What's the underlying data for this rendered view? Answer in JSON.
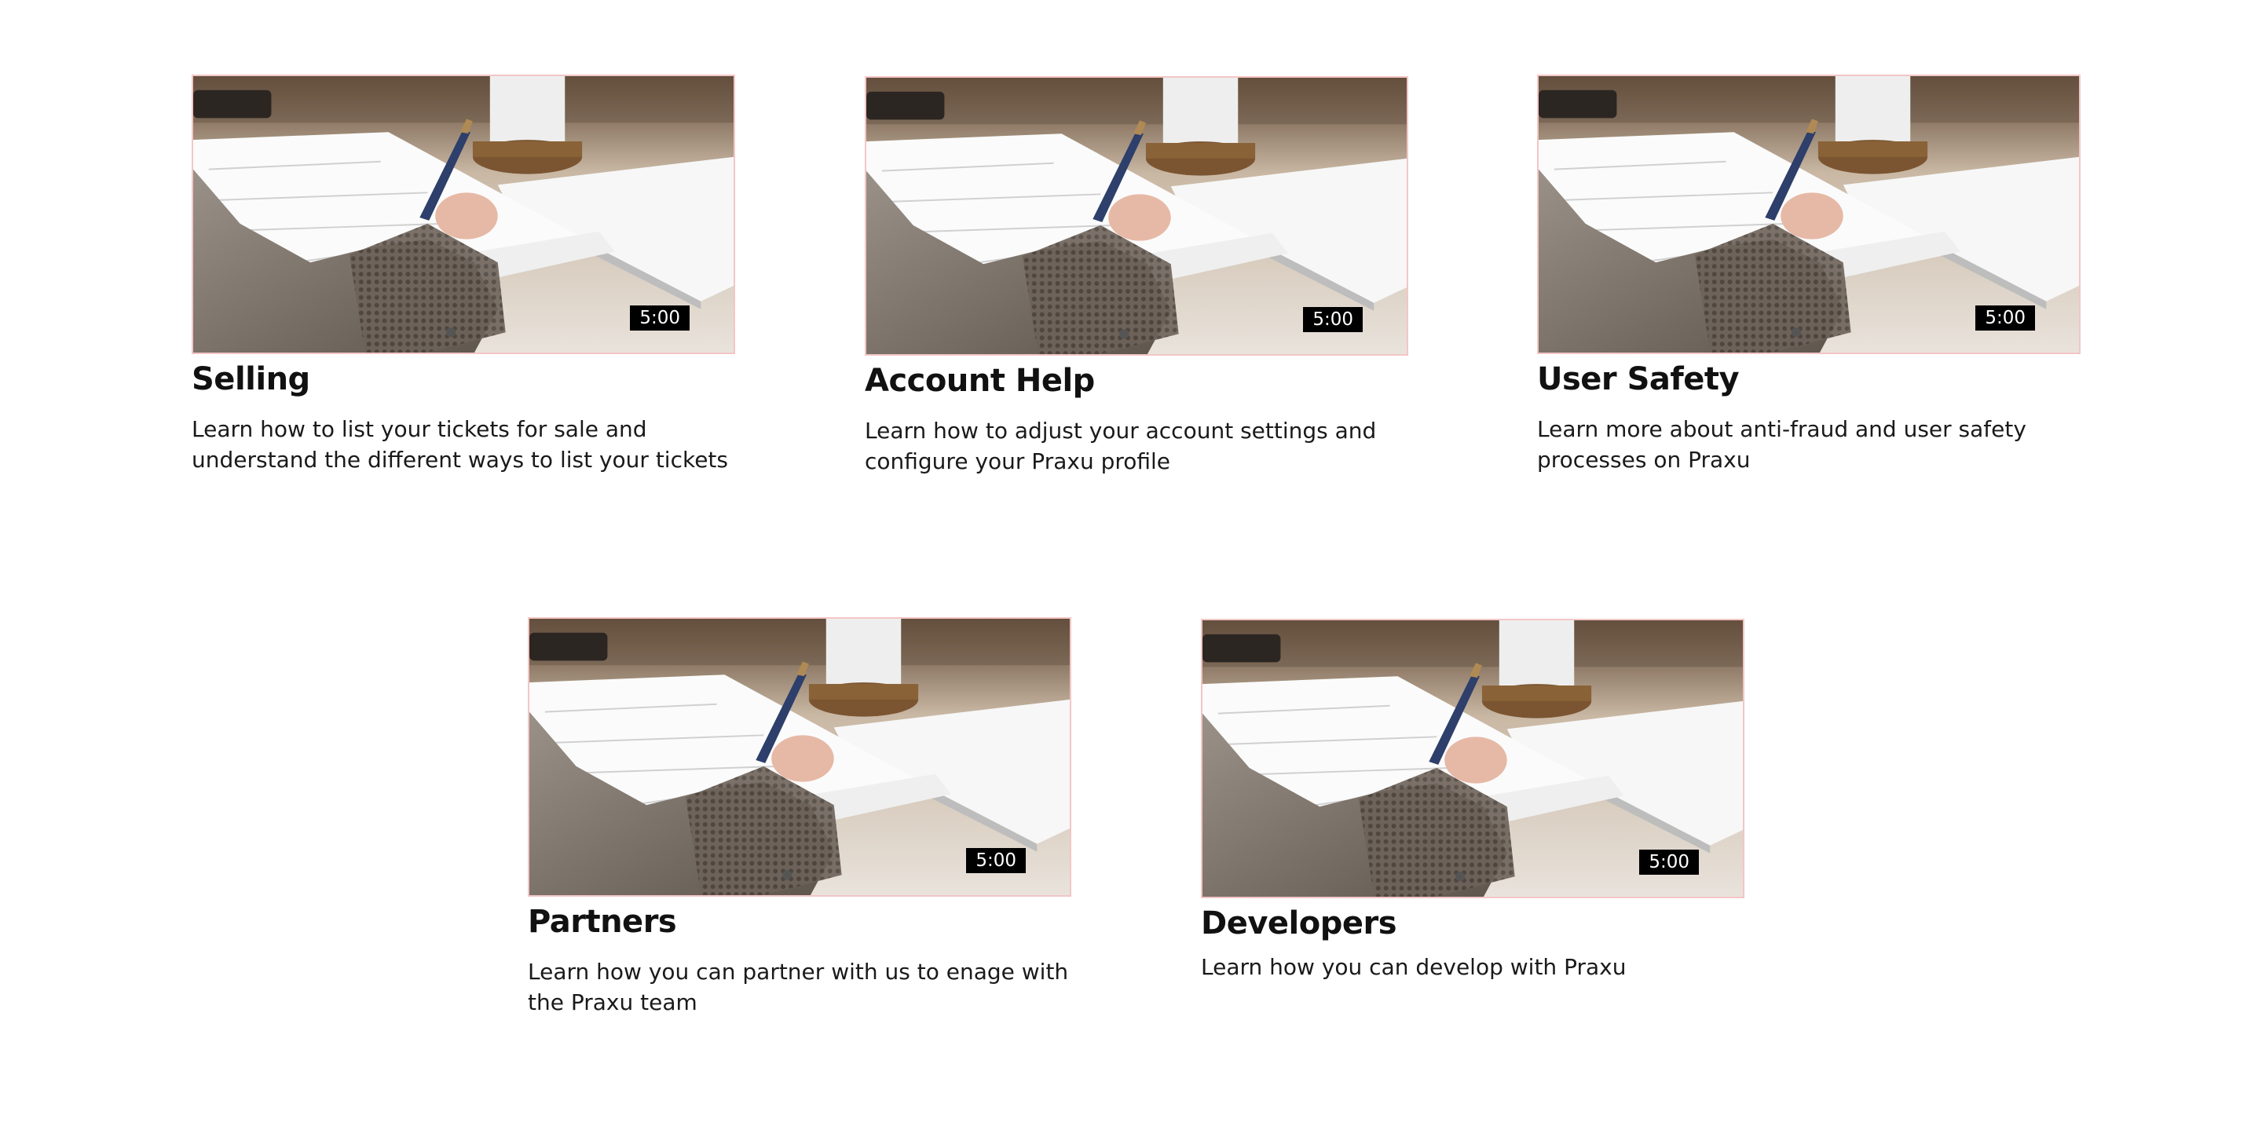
{
  "cards": [
    {
      "title": "Selling",
      "description": "Learn how to list your tickets for sale and understand the different ways to list your tickets",
      "duration": "5:00"
    },
    {
      "title": "Account Help",
      "description": "Learn how to adjust your account settings and configure your Praxu profile",
      "duration": "5:00"
    },
    {
      "title": "User Safety",
      "description": "Learn more about anti-fraud and user safety processes on Praxu",
      "duration": "5:00"
    },
    {
      "title": "Partners",
      "description": "Learn how you can partner with us to enage with the Praxu team",
      "duration": "5:00"
    },
    {
      "title": "Developers",
      "description": "Learn how you can develop with Praxu",
      "duration": "5:00"
    }
  ],
  "colors": {
    "thumbnail_border": "#f3c6c6",
    "duration_badge_bg": "#000000",
    "text": "#111111"
  }
}
